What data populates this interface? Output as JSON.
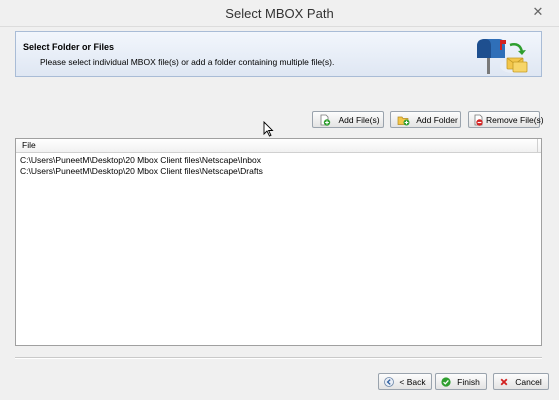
{
  "window": {
    "title": "Select MBOX Path",
    "close_label": "✕"
  },
  "header": {
    "title": "Select Folder or Files",
    "description": "Please select individual MBOX file(s) or add a folder containing multiple file(s)."
  },
  "toolbar": {
    "add_files_label": "Add File(s)",
    "add_folder_label": "Add Folder",
    "remove_files_label": "Remove File(s)"
  },
  "file_list": {
    "column_header": "File",
    "rows": [
      "C:\\Users\\PuneetM\\Desktop\\20 Mbox Client files\\Netscape\\Inbox",
      "C:\\Users\\PuneetM\\Desktop\\20 Mbox Client files\\Netscape\\Drafts"
    ]
  },
  "footer": {
    "back_label": "< Back",
    "finish_label": "Finish",
    "cancel_label": "Cancel"
  },
  "colors": {
    "header_border": "#a9bcd6",
    "add_green": "#2e9e2e",
    "remove_red": "#d22020"
  },
  "icons": [
    "close-icon",
    "mailbox-logo-icon",
    "add-file-icon",
    "add-folder-icon",
    "remove-file-icon",
    "back-arrow-icon",
    "finish-check-icon",
    "cancel-x-icon",
    "mouse-cursor-icon"
  ]
}
